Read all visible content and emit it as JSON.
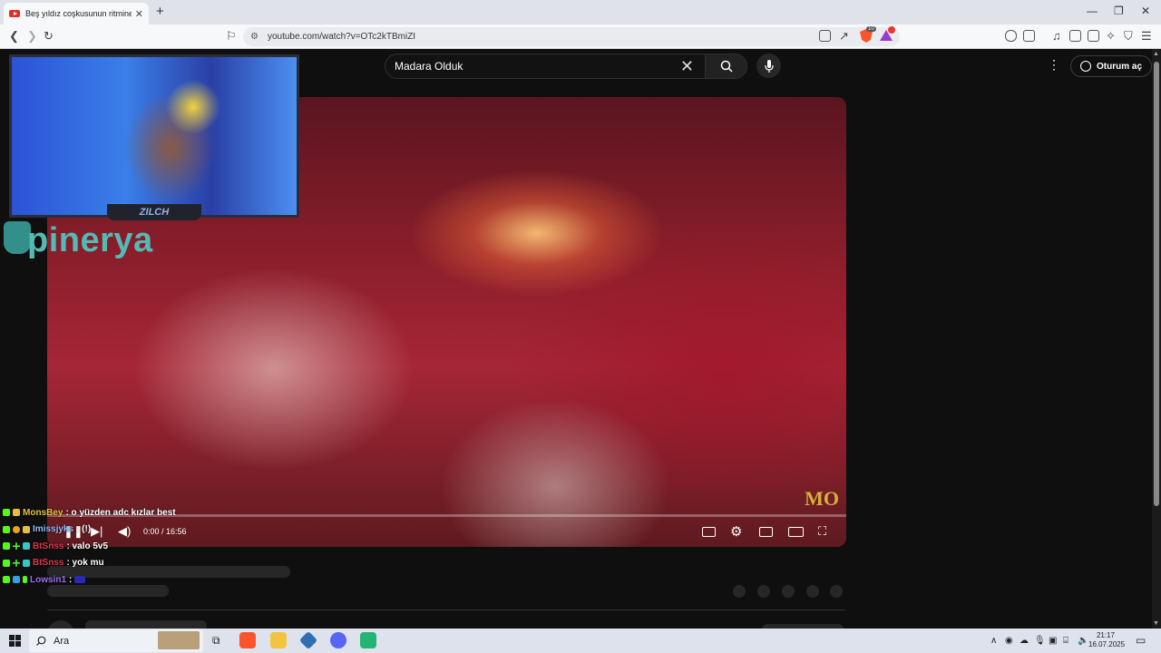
{
  "browser": {
    "tab_title": "Beş yıldız coşkusunun ritmine kı",
    "new_tab": "+",
    "url": "youtube.com/watch?v=OTc2kTBmiZI",
    "brave_shield_count": "10",
    "rewards_badge": "1"
  },
  "youtube": {
    "search_value": "Madara Olduk",
    "sign_in_label": "Oturum aç",
    "video": {
      "time": "0:00 / 16:56",
      "watermark": "MO",
      "progress_fraction": 0
    }
  },
  "overlay": {
    "streamer_name": "ZILCH",
    "brand": "pinerya"
  },
  "chat": [
    {
      "user": "MonsBey",
      "message": " : o yüzden adc kızlar best",
      "color": "#e5c040"
    },
    {
      "user": "Imissjyks",
      "message": " : (!)",
      "color": "#8fb8ff"
    },
    {
      "user": "BtSnss",
      "message": " : valo 5v5",
      "color": "#e0344a"
    },
    {
      "user": "BtSnss",
      "message": " : yok mu",
      "color": "#e0344a"
    },
    {
      "user": "Lowsin1",
      "message": " : ",
      "color": "#9c6df0"
    }
  ],
  "taskbar": {
    "search_label": "Ara",
    "time": "21:17",
    "date": "16.07.2025"
  }
}
